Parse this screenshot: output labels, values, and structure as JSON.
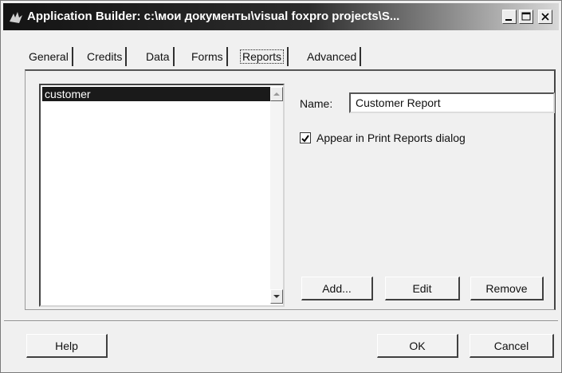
{
  "window": {
    "title": "Application Builder: c:\\мои документы\\visual foxpro projects\\S..."
  },
  "tabs": [
    {
      "label": "General",
      "active": false
    },
    {
      "label": "Credits",
      "active": false
    },
    {
      "label": "Data",
      "active": false
    },
    {
      "label": "Forms",
      "active": false
    },
    {
      "label": "Reports",
      "active": true
    },
    {
      "label": "Advanced",
      "active": false
    }
  ],
  "reports_list": {
    "items": [
      "customer"
    ],
    "selected": "customer"
  },
  "details": {
    "name_label": "Name:",
    "name_value": "Customer Report",
    "appear_checkbox_label": "Appear in Print Reports dialog",
    "appear_checked": true
  },
  "actions": {
    "add_label": "Add...",
    "edit_label": "Edit",
    "remove_label": "Remove"
  },
  "footer": {
    "help_label": "Help",
    "ok_label": "OK",
    "cancel_label": "Cancel"
  },
  "icons": {
    "app": "foxpro-icon",
    "minimize": "minimize-icon",
    "maximize": "maximize-icon",
    "close": "close-icon",
    "scroll_up": "scroll-up-arrow-icon",
    "scroll_down": "scroll-down-arrow-icon",
    "check": "check-mark-icon"
  }
}
